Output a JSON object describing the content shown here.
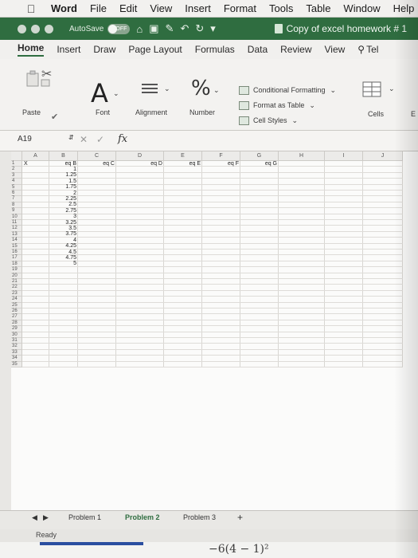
{
  "menubar": {
    "app": "Word",
    "items": [
      "File",
      "Edit",
      "View",
      "Insert",
      "Format",
      "Tools",
      "Table",
      "Window",
      "Help"
    ]
  },
  "titlebar": {
    "autosave_label": "AutoSave",
    "autosave_state": "OFF",
    "doc_title": "Copy of excel homework # 1"
  },
  "tabs": [
    "Home",
    "Insert",
    "Draw",
    "Page Layout",
    "Formulas",
    "Data",
    "Review",
    "View",
    "Tel"
  ],
  "ribbon": {
    "paste": "Paste",
    "font": "Font",
    "alignment": "Alignment",
    "number": "Number",
    "conditional_formatting": "Conditional Formatting",
    "format_as_table": "Format as Table",
    "cell_styles": "Cell Styles",
    "cells": "Cells",
    "editing_partial": "E"
  },
  "formula_bar": {
    "name_box": "A19",
    "fx": "fx"
  },
  "grid": {
    "columns": [
      "A",
      "B",
      "C",
      "D",
      "E",
      "F",
      "G",
      "H",
      "I",
      "J"
    ],
    "header_row": [
      "X",
      "eq B",
      "eq C",
      "eq D",
      "eq E",
      "eq F",
      "eq G"
    ],
    "b_values": [
      "1",
      "1.25",
      "1.5",
      "1.75",
      "2",
      "2.25",
      "2.5",
      "2.75",
      "3",
      "3.25",
      "3.5",
      "3.75",
      "4",
      "4.25",
      "4.5",
      "4.75",
      "5"
    ],
    "row_count": 35
  },
  "sheets": {
    "tabs": [
      "Problem 1",
      "Problem 2",
      "Problem 3"
    ],
    "active": "Problem 2",
    "add": "+"
  },
  "status": {
    "ready": "Ready"
  },
  "strip": {
    "expression": "−6(4 − 1)²"
  },
  "colors": {
    "accent": "#2f6d40",
    "progress": "#2b4ea0"
  }
}
